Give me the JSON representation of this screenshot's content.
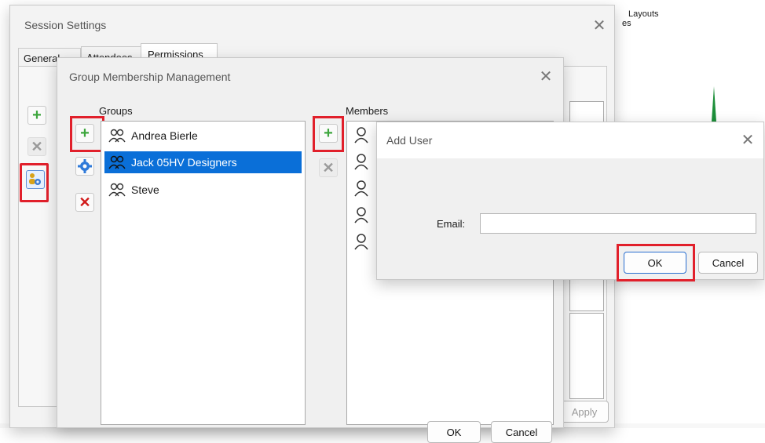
{
  "background": {
    "snippet_top": "Layouts",
    "snippet_sub": "es"
  },
  "session": {
    "title": "Session Settings",
    "tabs": [
      "General",
      "Attendees",
      "Permissions"
    ],
    "apply_label": "Apply"
  },
  "group_dialog": {
    "title": "Group Membership Management",
    "groups_label": "Groups",
    "members_label": "Members",
    "groups": [
      "Andrea Bierle",
      "Jack 05HV Designers",
      "Steve"
    ],
    "selected_group_index": 1,
    "member_count_visible": 5,
    "ok_label": "OK",
    "cancel_label": "Cancel"
  },
  "add_user": {
    "title": "Add User",
    "email_label": "Email:",
    "email_value": "",
    "ok_label": "OK",
    "cancel_label": "Cancel"
  },
  "colors": {
    "highlight": "#e1202b",
    "selection": "#0a6fd8",
    "add_green": "#3da63d",
    "delete_red": "#d11a1a"
  }
}
